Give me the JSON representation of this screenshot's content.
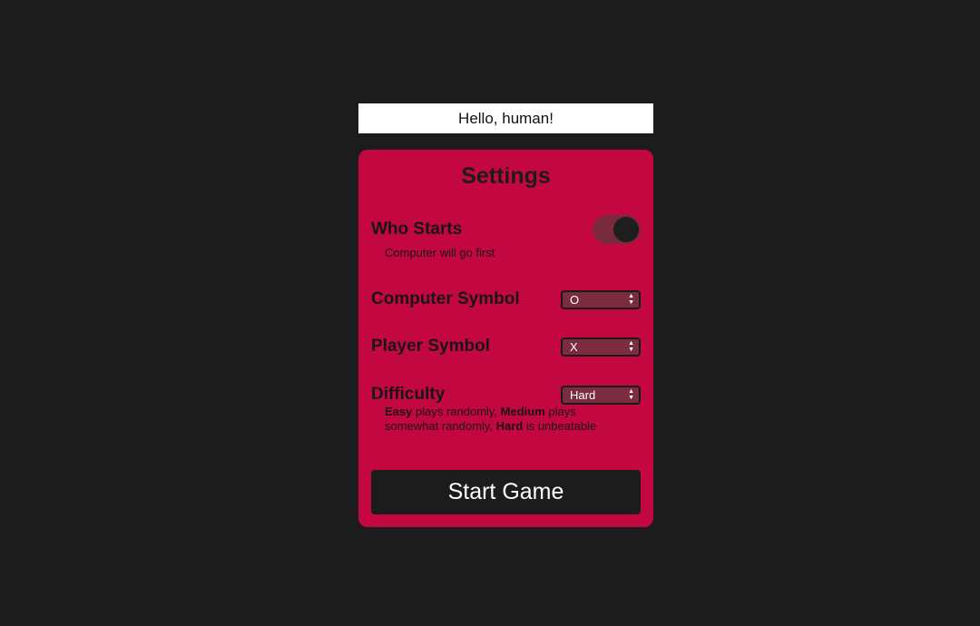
{
  "greeting": "Hello, human!",
  "settings": {
    "title": "Settings",
    "who_starts": {
      "label": "Who Starts",
      "toggle_on": true,
      "hint": "Computer will go first"
    },
    "computer_symbol": {
      "label": "Computer Symbol",
      "value": "O"
    },
    "player_symbol": {
      "label": "Player Symbol",
      "value": "X"
    },
    "difficulty": {
      "label": "Difficulty",
      "value": "Hard",
      "hint_parts": {
        "easy": "Easy",
        "easy_text": " plays randomly, ",
        "medium": "Medium",
        "medium_text": " plays somewhat randomly, ",
        "hard": "Hard",
        "hard_text": " is unbeatable"
      }
    },
    "start_button": "Start Game"
  },
  "colors": {
    "background": "#1c1c1d",
    "panel": "#c30740",
    "control": "#7b2c3f"
  }
}
